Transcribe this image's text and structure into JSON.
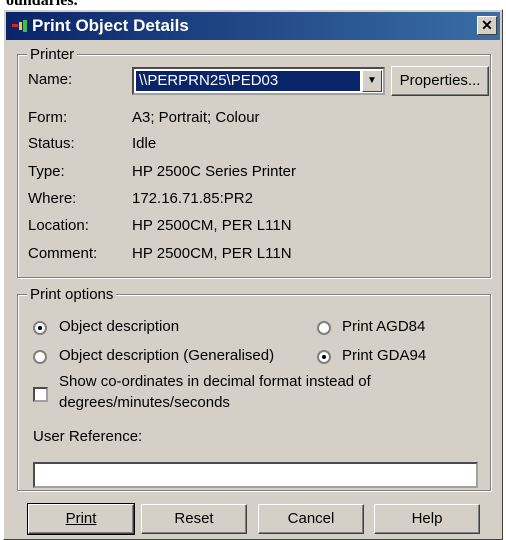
{
  "top_strip_text": "oundaries.",
  "window": {
    "title": "Print Object Details",
    "close_glyph": "✕"
  },
  "printer": {
    "legend": "Printer",
    "name_label": "Name:",
    "name_value": "\\\\PERPRN25\\PED03",
    "properties_label": "Properties...",
    "fields": [
      {
        "label": "Form:",
        "value": "A3; Portrait; Colour"
      },
      {
        "label": "Status:",
        "value": "Idle"
      },
      {
        "label": "Type:",
        "value": "HP 2500C Series Printer"
      },
      {
        "label": "Where:",
        "value": "172.16.71.85:PR2"
      },
      {
        "label": "Location:",
        "value": "HP 2500CM, PER L11N"
      },
      {
        "label": "Comment:",
        "value": "HP 2500CM, PER L11N"
      }
    ]
  },
  "print_options": {
    "legend": "Print options",
    "object_description": {
      "label": "Object description",
      "selected": true
    },
    "object_description_generalised": {
      "label": "Object description (Generalised)",
      "selected": false
    },
    "print_agd84": {
      "label": "Print AGD84",
      "selected": false
    },
    "print_gda94": {
      "label": "Print GDA94",
      "selected": true
    },
    "decimal_format": {
      "label_line1": "Show co-ordinates in decimal format instead of",
      "label_line2": "degrees/minutes/seconds",
      "checked": false
    },
    "user_reference_label": "User Reference:",
    "user_reference_value": ""
  },
  "buttons": {
    "print": "Print",
    "reset": "Reset",
    "cancel": "Cancel",
    "help": "Help"
  },
  "colors": {
    "titlebar_start": "#0a246a",
    "titlebar_end": "#3a6ea5",
    "dialog_face": "#d4d0c8"
  }
}
